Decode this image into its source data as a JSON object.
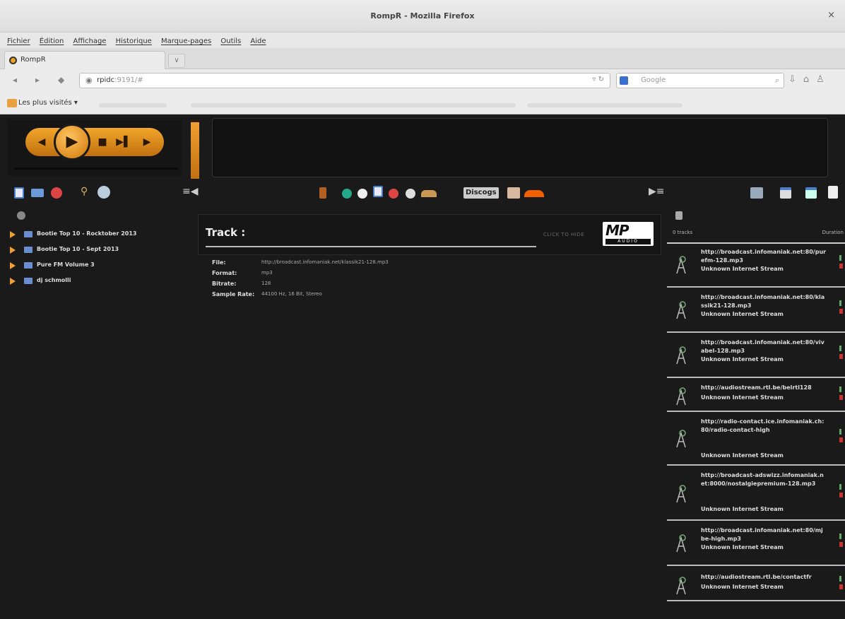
{
  "window": {
    "title": "RompR - Mozilla Firefox",
    "close": "×"
  },
  "menu": [
    "Fichier",
    "Édition",
    "Affichage",
    "Historique",
    "Marque-pages",
    "Outils",
    "Aide"
  ],
  "tab": {
    "label": "RompR",
    "new_tab": "∨"
  },
  "url": {
    "host": "rpidc",
    "path": ":9191/#"
  },
  "search": {
    "placeholder": "Google"
  },
  "bookmarks": {
    "label": "Les plus visités ▾"
  },
  "player": {
    "volume_fraction": 0.95
  },
  "toolbar": {
    "discogs": "Discogs"
  },
  "collection": [
    "Bootie Top 10 - Rocktober 2013",
    "Bootie Top 10 - Sept 2013",
    "Pure FM Volume 3",
    "dj schmolli"
  ],
  "info": {
    "label": "Track :",
    "hide": "CLICK TO HIDE",
    "mp3_logo": "MP",
    "mp3_audio": "AUDIO",
    "fields": [
      {
        "key": "File:",
        "value": "http://broadcast.infomaniak.net/klassik21-128.mp3"
      },
      {
        "key": "Format:",
        "value": "mp3"
      },
      {
        "key": "Bitrate:",
        "value": "128"
      },
      {
        "key": "Sample Rate:",
        "value": "44100 Hz, 16 Bit, Stereo"
      }
    ]
  },
  "playlist": {
    "tracks_label": "0 tracks",
    "duration_label": "Duration",
    "items": [
      {
        "url": "http://broadcast.infomaniak.net:80/purefm-128.mp3",
        "type": "Unknown Internet Stream"
      },
      {
        "url": "http://broadcast.infomaniak.net:80/klassik21-128.mp3",
        "type": "Unknown Internet Stream"
      },
      {
        "url": "http://broadcast.infomaniak.net:80/vivabel-128.mp3",
        "type": "Unknown Internet Stream"
      },
      {
        "url": "http://audiostream.rtl.be/belrtl128",
        "type": "Unknown Internet Stream"
      },
      {
        "url": "http://radio-contact.ice.infomaniak.ch:80/radio-contact-high",
        "type": "Unknown Internet Stream"
      },
      {
        "url": "http://broadcast-adswizz.infomaniak.net:8000/nostalgiepremium-128.mp3",
        "type": "Unknown Internet Stream"
      },
      {
        "url": "http://broadcast.infomaniak.net:80/mjbe-high.mp3",
        "type": "Unknown Internet Stream"
      },
      {
        "url": "http://audiostream.rtl.be/contactfr",
        "type": "Unknown Internet Stream"
      }
    ]
  }
}
